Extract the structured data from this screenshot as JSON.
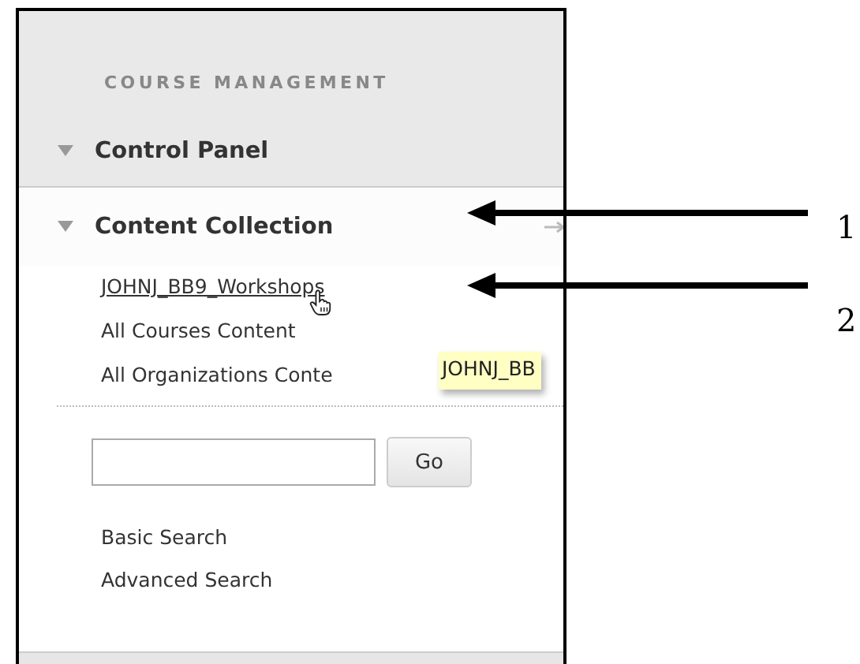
{
  "panel": {
    "heading": "COURSE MANAGEMENT",
    "sections": [
      {
        "title": "Control Panel",
        "expanded": true,
        "shaded": true
      },
      {
        "title": "Content Collection",
        "expanded": true,
        "shaded": false
      }
    ],
    "links": [
      {
        "label": "JOHNJ_BB9_Workshops",
        "hovered": true
      },
      {
        "label": "All Courses Content",
        "hovered": false
      },
      {
        "label": "All Organizations Conte",
        "hovered": false
      }
    ],
    "tooltip": "JOHNJ_BB",
    "search": {
      "button": "Go"
    },
    "search_links": [
      "Basic Search",
      "Advanced Search"
    ]
  },
  "callouts": [
    "1",
    "2"
  ]
}
